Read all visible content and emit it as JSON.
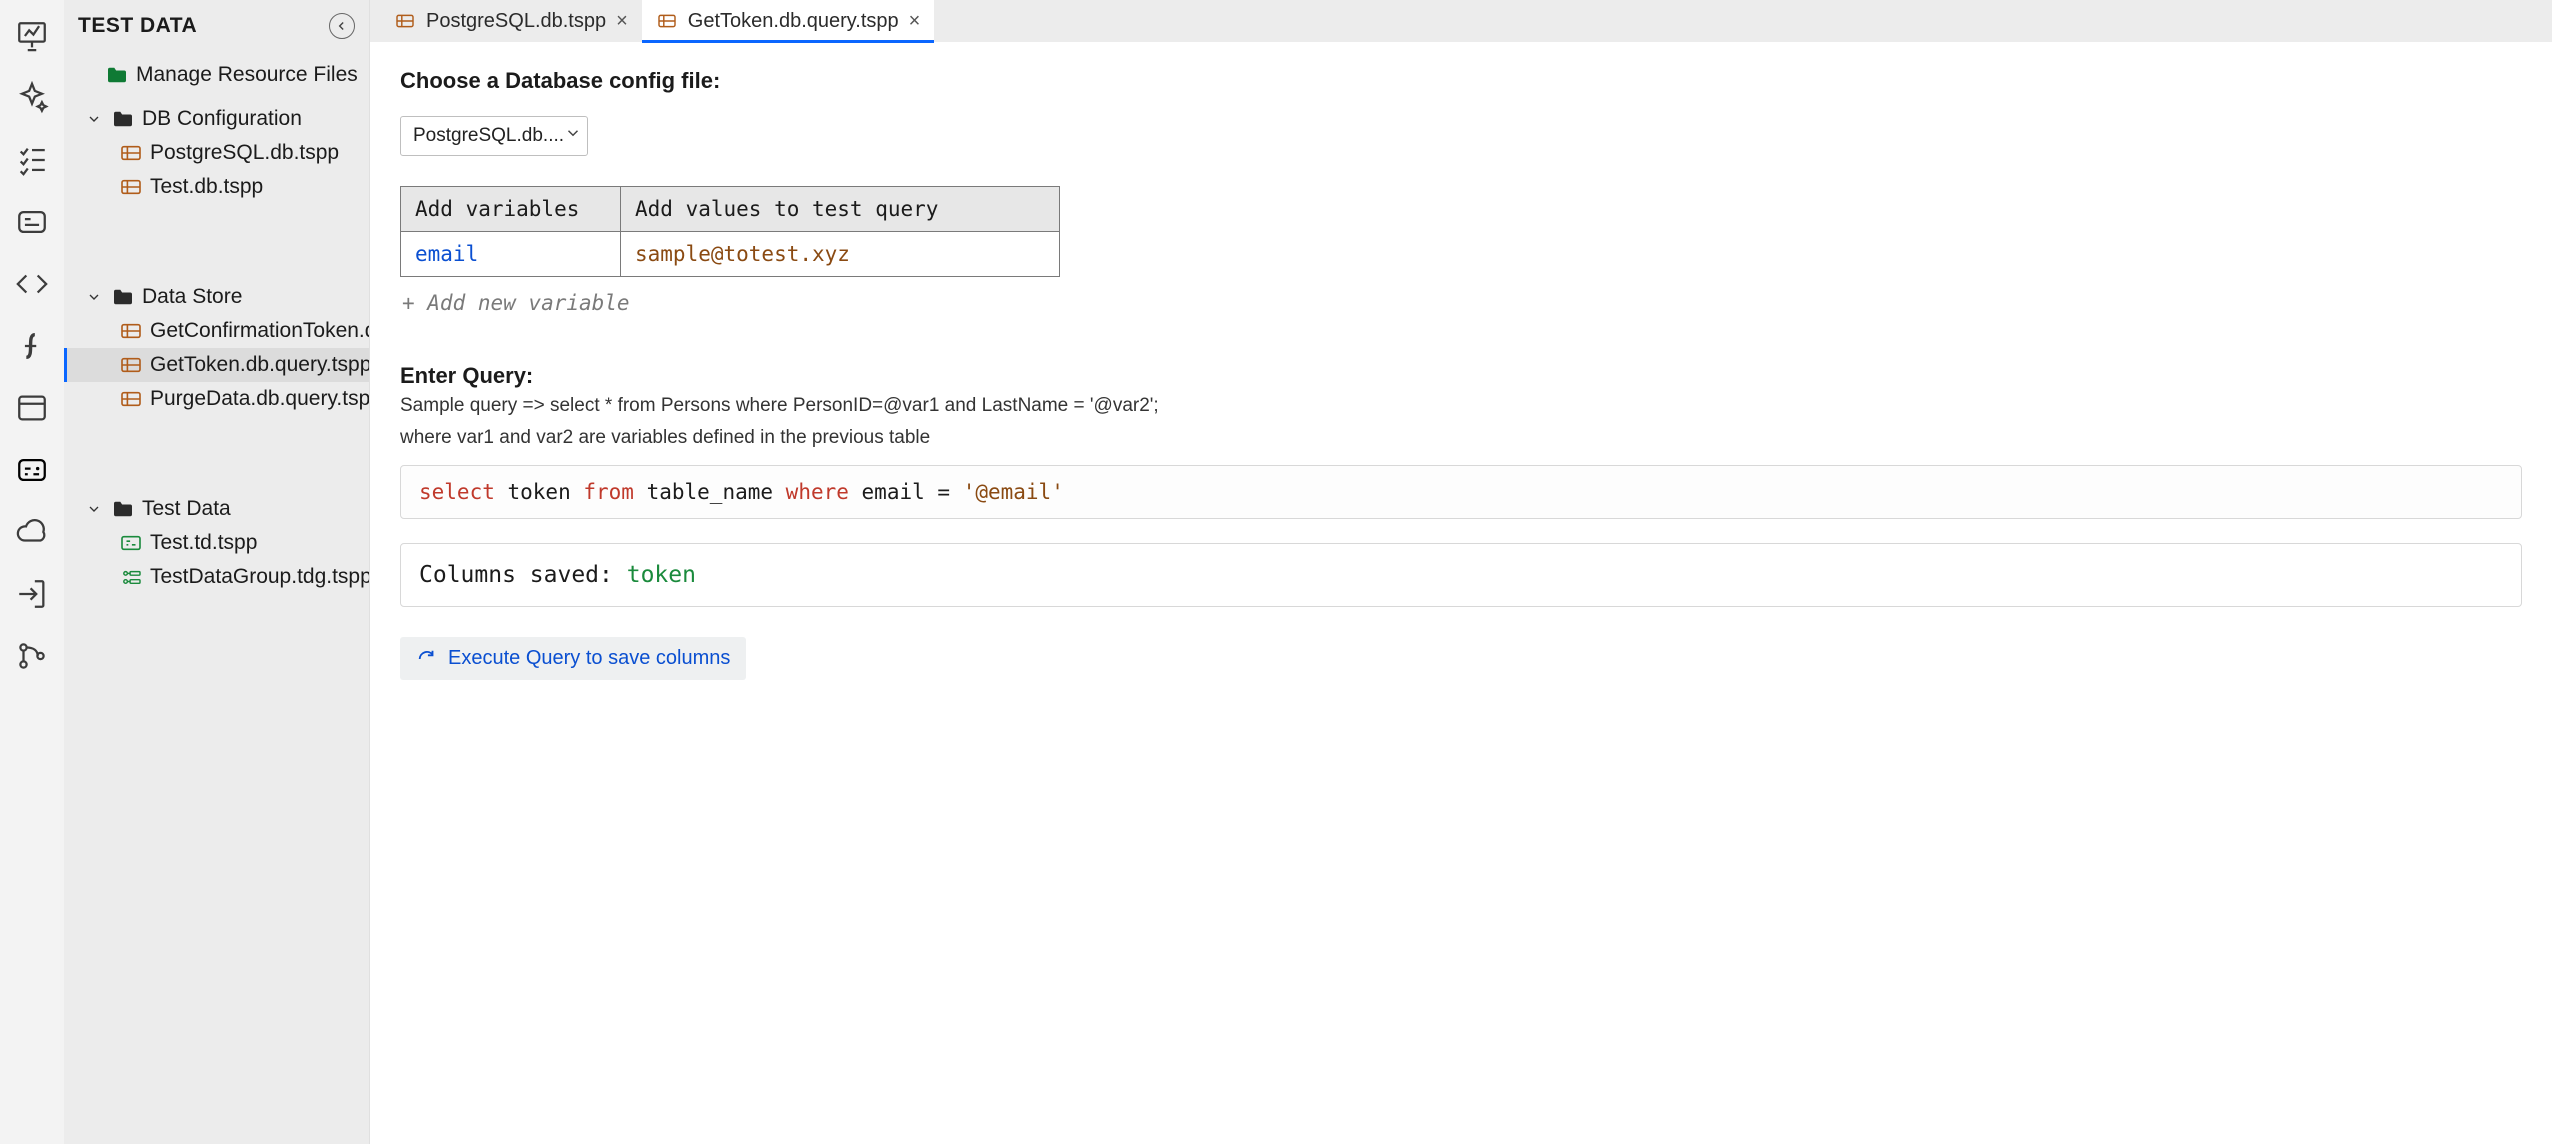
{
  "sidepanel": {
    "title": "TEST DATA",
    "manage_label": "Manage Resource Files",
    "sections": [
      {
        "name": "DB Configuration",
        "items": [
          "PostgreSQL.db.tspp",
          "Test.db.tspp"
        ]
      },
      {
        "name": "Data Store",
        "items": [
          "GetConfirmationToken.db.que",
          "GetToken.db.query.tspp",
          "PurgeData.db.query.tspp"
        ]
      },
      {
        "name": "Test Data",
        "items": [
          "Test.td.tspp",
          "TestDataGroup.tdg.tspp"
        ]
      }
    ],
    "selected_item": "GetToken.db.query.tspp"
  },
  "tabs": [
    {
      "label": "PostgreSQL.db.tspp",
      "active": false
    },
    {
      "label": "GetToken.db.query.tspp",
      "active": true
    }
  ],
  "editor": {
    "choose_title": "Choose a Database config file:",
    "db_select_value": "PostgreSQL.db....",
    "vars_header_key": "Add variables",
    "vars_header_val": "Add values to test query",
    "vars": [
      {
        "key": "email",
        "val": "sample@totest.xyz"
      }
    ],
    "add_var_label": "+ Add new variable",
    "enter_query_title": "Enter Query:",
    "sample_line1": "Sample query => select * from Persons where PersonID=@var1 and LastName = '@var2';",
    "sample_line2": "where var1 and var2 are variables defined in the previous table",
    "query_select": "select",
    "query_token": " token ",
    "query_from": "from",
    "query_table": " table_name ",
    "query_where": "where",
    "query_rest": " email = ",
    "query_str": "'@email'",
    "columns_label": "Columns saved: ",
    "columns_value": "token",
    "exec_label": "Execute Query to save columns"
  }
}
